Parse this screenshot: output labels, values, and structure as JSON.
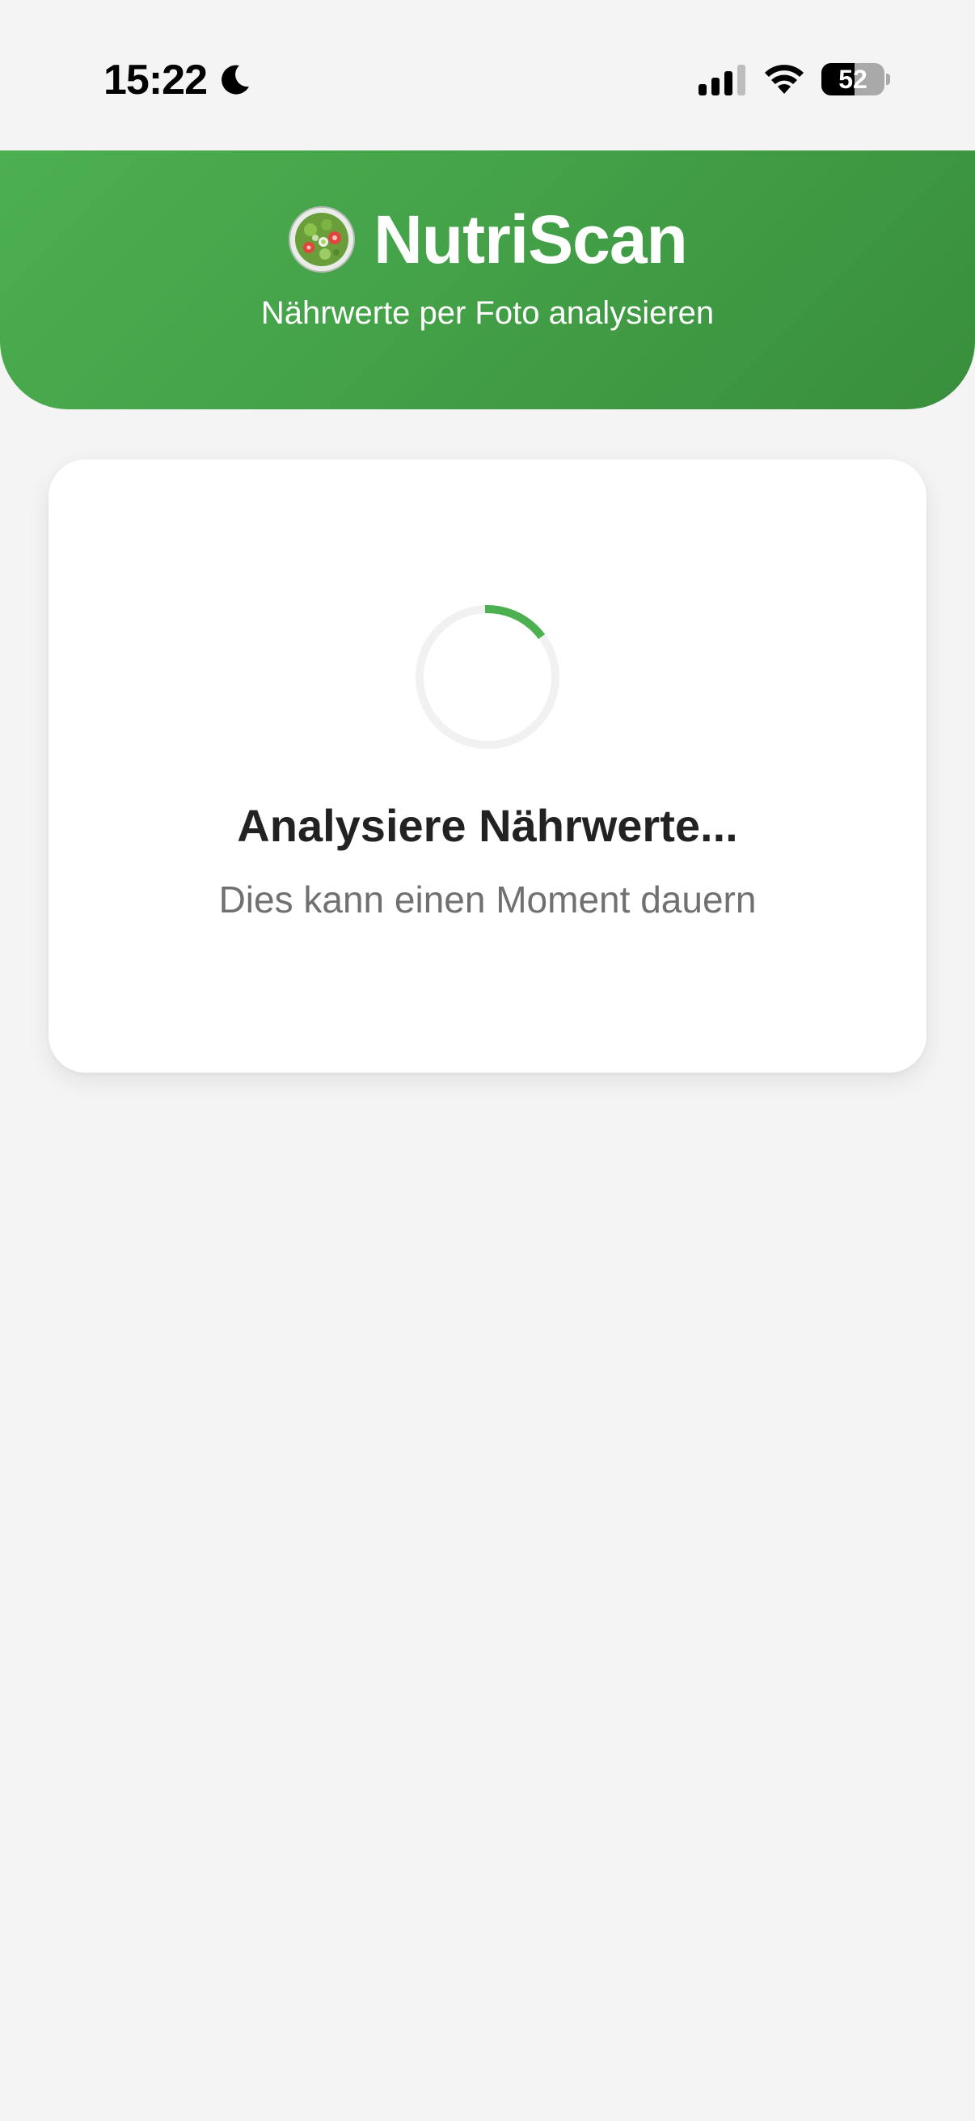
{
  "status_bar": {
    "time": "15:22",
    "battery_percent": "52",
    "battery_level": 0.52,
    "icons": [
      "moon-icon",
      "signal-icon",
      "wifi-icon",
      "battery-icon"
    ]
  },
  "header": {
    "logo_icon": "salad-icon",
    "title": "NutriScan",
    "subtitle": "Nährwerte per Foto analysieren",
    "gradient": [
      "#4caf50",
      "#388e3c"
    ]
  },
  "loading": {
    "spinner_icon": "spinner-icon",
    "title": "Analysiere Nährwerte...",
    "subtitle": "Dies kann einen Moment dauern",
    "accent_color": "#4caf50"
  }
}
